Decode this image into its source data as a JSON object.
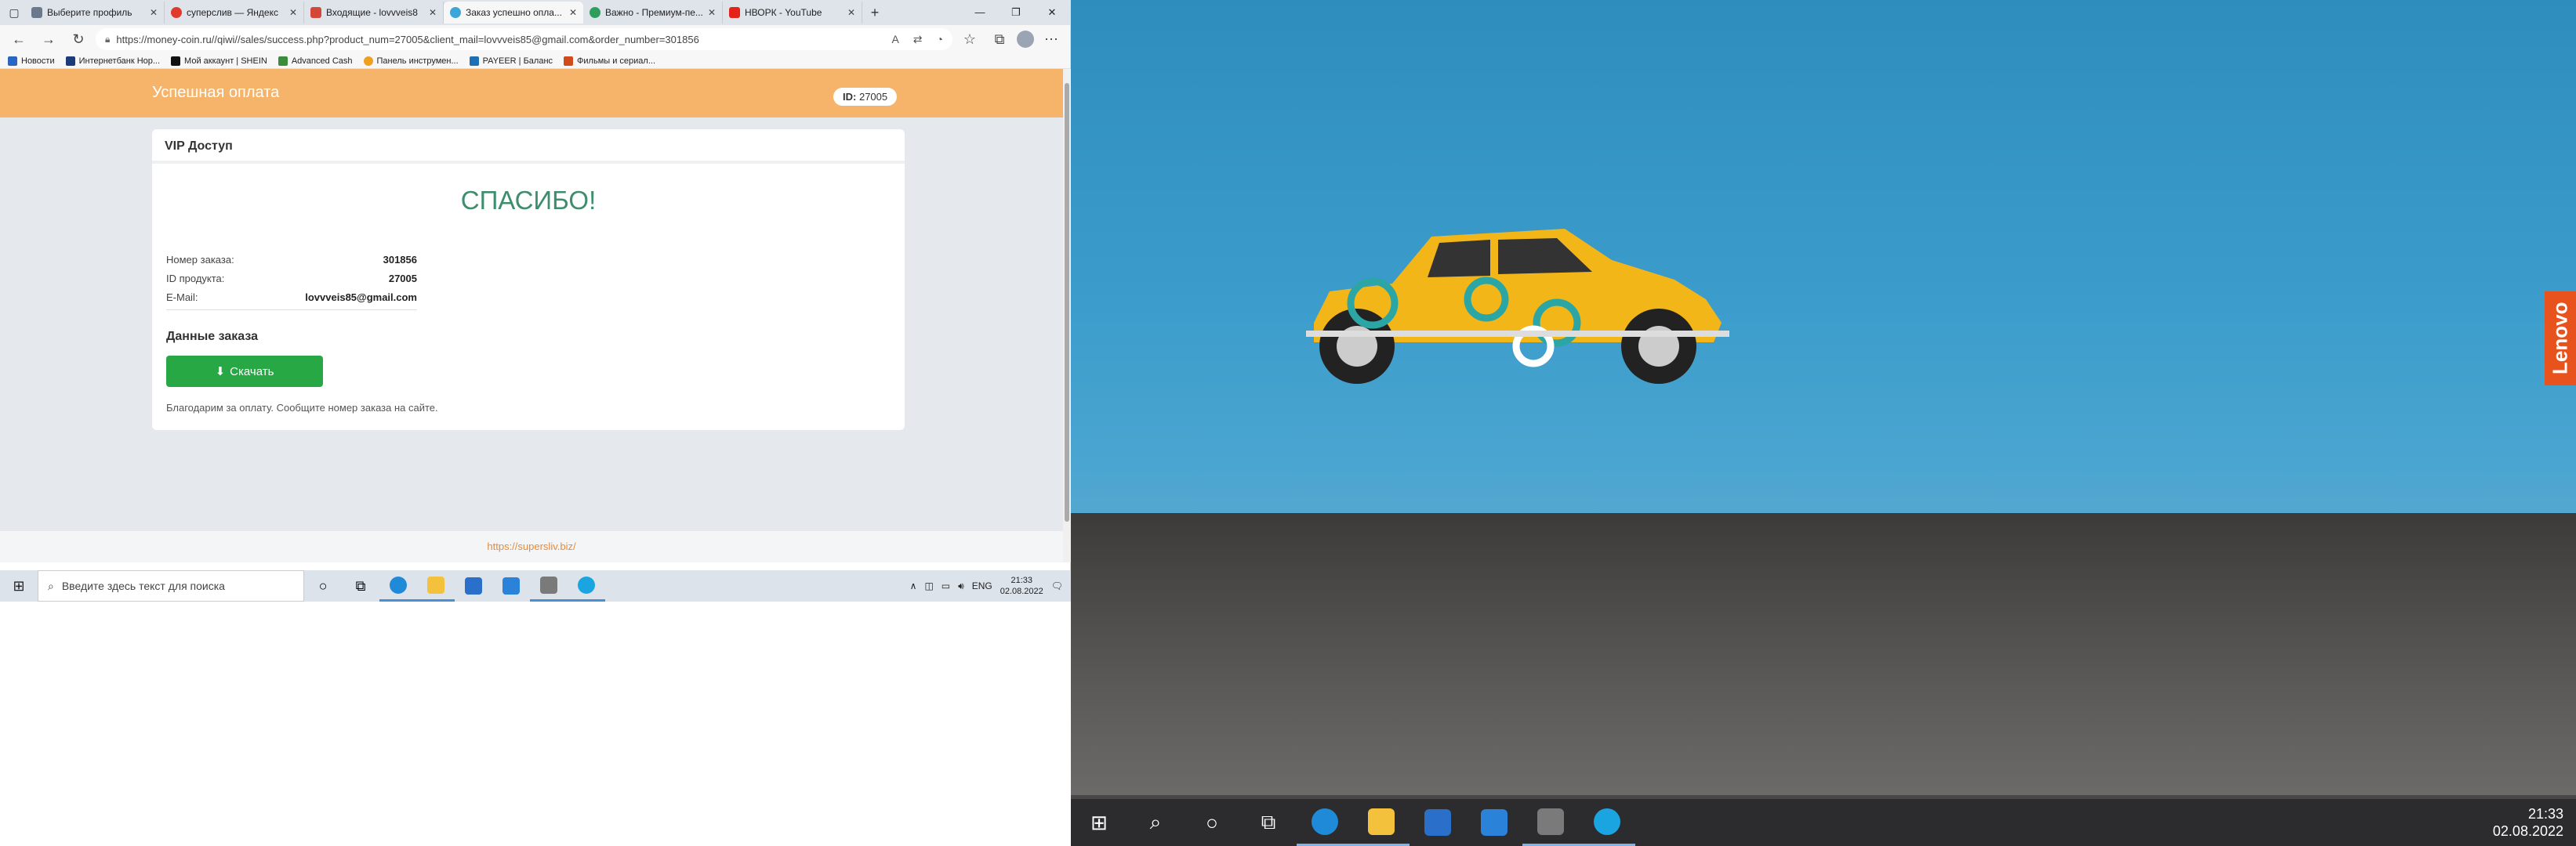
{
  "browser": {
    "tabs": [
      {
        "label": "Выберите профиль",
        "color": "#6a7a8c"
      },
      {
        "label": "суперслив — Яндекс",
        "color": "#e03a2c"
      },
      {
        "label": "Входящие - lovvveis8",
        "color": "#d44638"
      },
      {
        "label": "Заказ успешно опла...",
        "color": "#3aa7d8",
        "active": true
      },
      {
        "label": "Важно - Премиум-пе...",
        "color": "#2f9e5c"
      },
      {
        "label": "НВОРК - YouTube",
        "color": "#e62117"
      }
    ],
    "url": "https://money-coin.ru//qiwi//sales/success.php?product_num=27005&client_mail=lovvveis85@gmail.com&order_number=301856",
    "bookmarks": [
      {
        "label": "Новости",
        "color": "#2a64c5"
      },
      {
        "label": "Интернетбанк Нор...",
        "color": "#1c3b7a"
      },
      {
        "label": "Мой аккаунт | SHEIN",
        "color": "#111111"
      },
      {
        "label": "Advanced Cash",
        "color": "#3b8d3b"
      },
      {
        "label": "Панель инструмен...",
        "color": "#f0a020"
      },
      {
        "label": "PAYEER | Баланс",
        "color": "#1f6fb5"
      },
      {
        "label": "Фильмы и сериал...",
        "color": "#d14a1c"
      }
    ]
  },
  "page": {
    "header_title": "Успешная оплата",
    "id_label": "ID:",
    "id_value": "27005",
    "card_title": "VIP Доступ",
    "thanks": "СПАСИБО!",
    "order_label": "Номер заказа:",
    "order_value": "301856",
    "product_label": "ID продукта:",
    "product_value": "27005",
    "email_label": "E-Mail:",
    "email_value": "lovvveis85@gmail.com",
    "order_data_title": "Данные заказа",
    "download_label": "Скачать",
    "note": "Благодарим за оплату. Сообщите номер заказа на сайте.",
    "footer_link": "https://supersliv.biz/"
  },
  "taskbar_small": {
    "search_placeholder": "Введите здесь текст для поиска",
    "lang": "ENG",
    "time": "21:33",
    "date": "02.08.2022"
  },
  "desktop": {
    "brand": "Lenovo",
    "time": "21:33",
    "date": "02.08.2022"
  }
}
